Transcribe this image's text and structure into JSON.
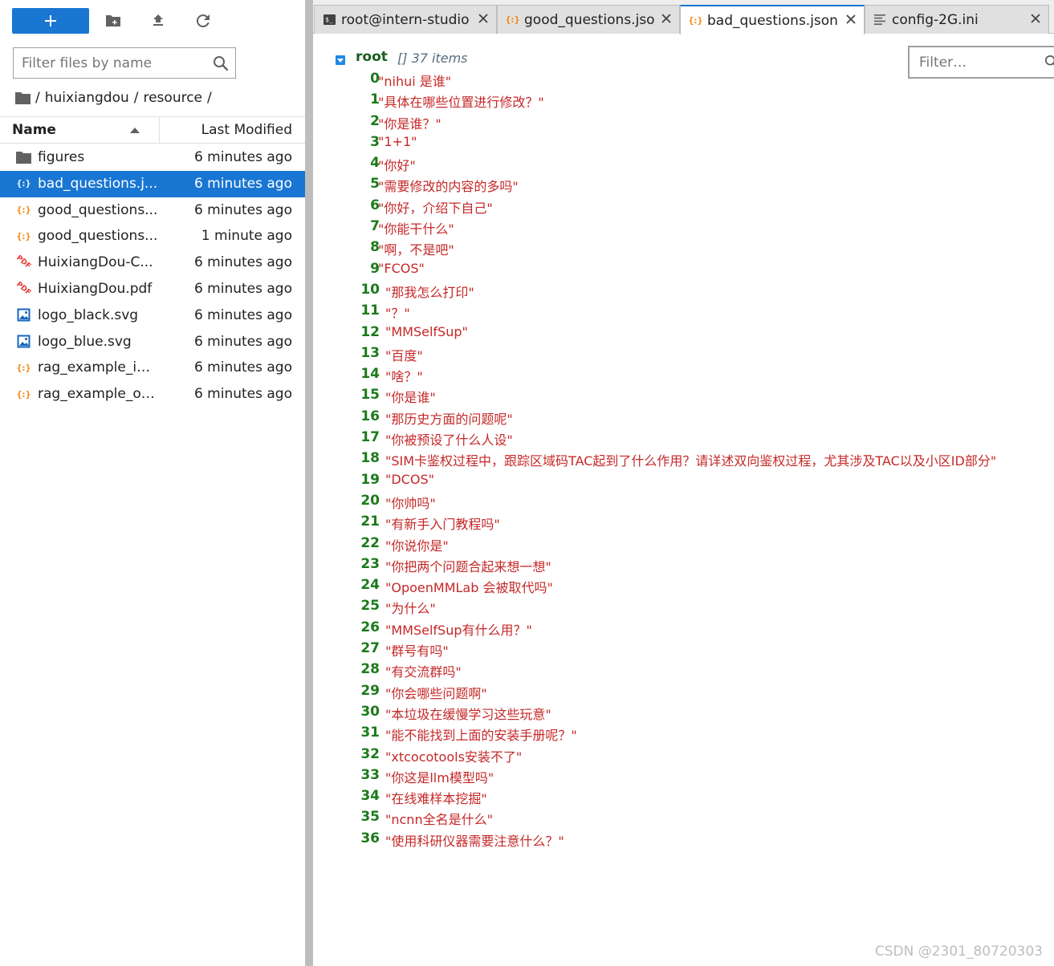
{
  "file_browser": {
    "toolbar": {
      "new_label": "+",
      "icons": [
        "plus-icon",
        "new-folder-icon",
        "upload-icon",
        "refresh-icon"
      ]
    },
    "filter_placeholder": "Filter files by name",
    "breadcrumb": [
      "/",
      "huixiangdou",
      "/",
      "resource",
      "/"
    ],
    "columns": {
      "name": "Name",
      "modified": "Last Modified"
    },
    "files": [
      {
        "name": "figures",
        "type": "folder",
        "modified": "6 minutes ago",
        "selected": false
      },
      {
        "name": "bad_questions.j...",
        "type": "json",
        "modified": "6 minutes ago",
        "selected": true
      },
      {
        "name": "good_questions...",
        "type": "json",
        "modified": "6 minutes ago",
        "selected": false
      },
      {
        "name": "good_questions...",
        "type": "json",
        "modified": "1 minute ago",
        "selected": false
      },
      {
        "name": "HuixiangDou-C...",
        "type": "pdf",
        "modified": "6 minutes ago",
        "selected": false
      },
      {
        "name": "HuixiangDou.pdf",
        "type": "pdf",
        "modified": "6 minutes ago",
        "selected": false
      },
      {
        "name": "logo_black.svg",
        "type": "image",
        "modified": "6 minutes ago",
        "selected": false
      },
      {
        "name": "logo_blue.svg",
        "type": "image",
        "modified": "6 minutes ago",
        "selected": false
      },
      {
        "name": "rag_example_in...",
        "type": "json",
        "modified": "6 minutes ago",
        "selected": false
      },
      {
        "name": "rag_example_ou...",
        "type": "json",
        "modified": "6 minutes ago",
        "selected": false
      }
    ]
  },
  "tabs": [
    {
      "label": "root@intern-studio",
      "icon": "terminal-icon",
      "active": false
    },
    {
      "label": "good_questions.jso",
      "icon": "json-icon",
      "active": false
    },
    {
      "label": "bad_questions.json",
      "icon": "json-icon",
      "active": true
    },
    {
      "label": "config-2G.ini",
      "icon": "text-file-icon",
      "active": false
    }
  ],
  "json_viewer": {
    "root_label": "root",
    "root_type": "[]  37 items",
    "filter_placeholder": "Filter…",
    "items": [
      {
        "key": "0",
        "value": "\"nihui 是谁\""
      },
      {
        "key": "1",
        "value": "\"具体在哪些位置进行修改？\""
      },
      {
        "key": "2",
        "value": "\"你是谁？\""
      },
      {
        "key": "3",
        "value": "\"1+1\""
      },
      {
        "key": "4",
        "value": "\"你好\""
      },
      {
        "key": "5",
        "value": "\"需要修改的内容的多吗\""
      },
      {
        "key": "6",
        "value": "\"你好，介绍下自己\""
      },
      {
        "key": "7",
        "value": "\"你能干什么\""
      },
      {
        "key": "8",
        "value": "\"啊，不是吧\""
      },
      {
        "key": "9",
        "value": "\"FCOS\""
      },
      {
        "key": "10",
        "value": "\"那我怎么打印\""
      },
      {
        "key": "11",
        "value": "\"？\""
      },
      {
        "key": "12",
        "value": "\"MMSelfSup\""
      },
      {
        "key": "13",
        "value": "\"百度\""
      },
      {
        "key": "14",
        "value": "\"啥？\""
      },
      {
        "key": "15",
        "value": "\"你是谁\""
      },
      {
        "key": "16",
        "value": "\"那历史方面的问题呢\""
      },
      {
        "key": "17",
        "value": "\"你被预设了什么人设\""
      },
      {
        "key": "18",
        "value": "\"SIM卡鉴权过程中，跟踪区域码TAC起到了什么作用？请详述双向鉴权过程，尤其涉及TAC以及小区ID部分\""
      },
      {
        "key": "19",
        "value": "\"DCOS\""
      },
      {
        "key": "20",
        "value": "\"你帅吗\""
      },
      {
        "key": "21",
        "value": "\"有新手入门教程吗\""
      },
      {
        "key": "22",
        "value": "\"你说你是\""
      },
      {
        "key": "23",
        "value": "\"你把两个问题合起来想一想\""
      },
      {
        "key": "24",
        "value": "\"OpoenMMLab 会被取代吗\""
      },
      {
        "key": "25",
        "value": "\"为什么\""
      },
      {
        "key": "26",
        "value": "\"MMSelfSup有什么用？\""
      },
      {
        "key": "27",
        "value": "\"群号有吗\""
      },
      {
        "key": "28",
        "value": "\"有交流群吗\""
      },
      {
        "key": "29",
        "value": "\"你会哪些问题啊\""
      },
      {
        "key": "30",
        "value": "\"本垃圾在缓慢学习这些玩意\""
      },
      {
        "key": "31",
        "value": "\"能不能找到上面的安装手册呢？\""
      },
      {
        "key": "32",
        "value": "\"xtcocotools安装不了\""
      },
      {
        "key": "33",
        "value": "\"你这是llm模型吗\""
      },
      {
        "key": "34",
        "value": "\"在线难样本挖掘\""
      },
      {
        "key": "35",
        "value": "\"ncnn全名是什么\""
      },
      {
        "key": "36",
        "value": "\"使用科研仪器需要注意什么？\""
      }
    ]
  },
  "watermark": "CSDN @2301_80720303",
  "colors": {
    "accent": "#1976d2",
    "json_key": "#1b7a1b",
    "json_string": "#c62828",
    "json_icon": "#f57c00",
    "pdf_icon": "#e53935"
  }
}
